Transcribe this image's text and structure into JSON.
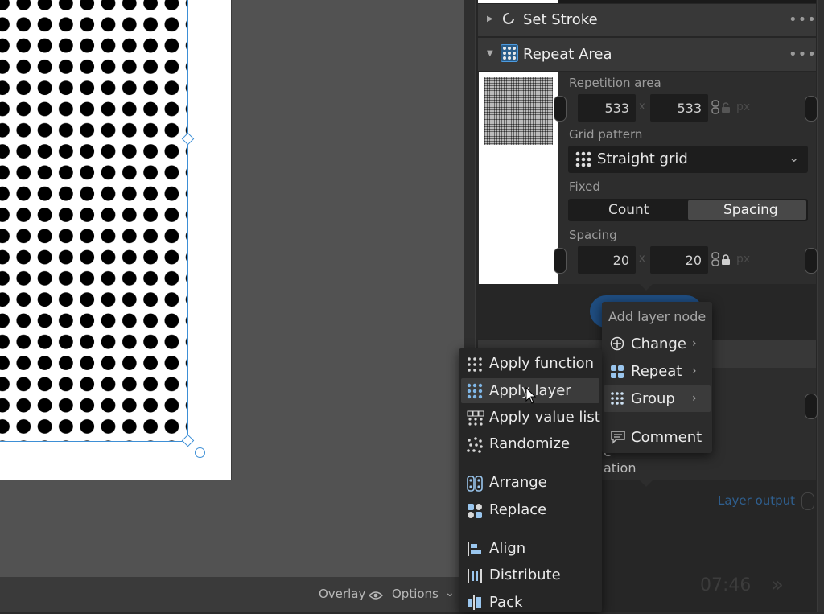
{
  "canvas": {
    "bottom_bar": {
      "overlay_label": "Overlay",
      "options_label": "Options"
    }
  },
  "panel": {
    "set_stroke": {
      "title": "Set Stroke",
      "more": "•••"
    },
    "repeat_area": {
      "title": "Repeat Area",
      "more": "•••",
      "repetition_area_label": "Repetition area",
      "area_width": "533",
      "area_height": "533",
      "x_sep": "x",
      "unit": "px",
      "grid_pattern_label": "Grid pattern",
      "grid_pattern_value": "Straight grid",
      "fixed_label": "Fixed",
      "fixed_options": [
        "Count",
        "Spacing"
      ],
      "fixed_selected": "Spacing",
      "spacing_label": "Spacing",
      "spacing_x": "20",
      "spacing_y": "20"
    },
    "partial_text": {
      "line1": "e",
      "line2": "ation"
    },
    "layer_output_label": "Layer output",
    "footer_counter": "07:46"
  },
  "add_layer_menu": {
    "title": "Add layer node",
    "items": [
      {
        "label": "Change",
        "icon": "change-icon",
        "submenu": true
      },
      {
        "label": "Repeat",
        "icon": "repeat-icon",
        "submenu": true
      },
      {
        "label": "Group",
        "icon": "group-icon",
        "submenu": true,
        "highlighted": true
      },
      {
        "label": "Comment",
        "icon": "comment-icon",
        "submenu": false
      }
    ]
  },
  "group_submenu": {
    "items": [
      {
        "label": "Apply function",
        "icon": "apply-function-icon"
      },
      {
        "label": "Apply layer",
        "icon": "apply-layer-icon",
        "highlighted": true
      },
      {
        "label": "Apply value list",
        "icon": "apply-value-list-icon"
      },
      {
        "label": "Randomize",
        "icon": "randomize-icon"
      },
      {
        "label": "Arrange",
        "icon": "arrange-icon"
      },
      {
        "label": "Replace",
        "icon": "replace-icon"
      },
      {
        "label": "Align",
        "icon": "align-icon"
      },
      {
        "label": "Distribute",
        "icon": "distribute-icon"
      },
      {
        "label": "Pack",
        "icon": "pack-icon"
      }
    ]
  },
  "colors": {
    "accent": "#3d8fd6",
    "highlight": "#3b3b3b",
    "panel_bg": "#262626"
  }
}
